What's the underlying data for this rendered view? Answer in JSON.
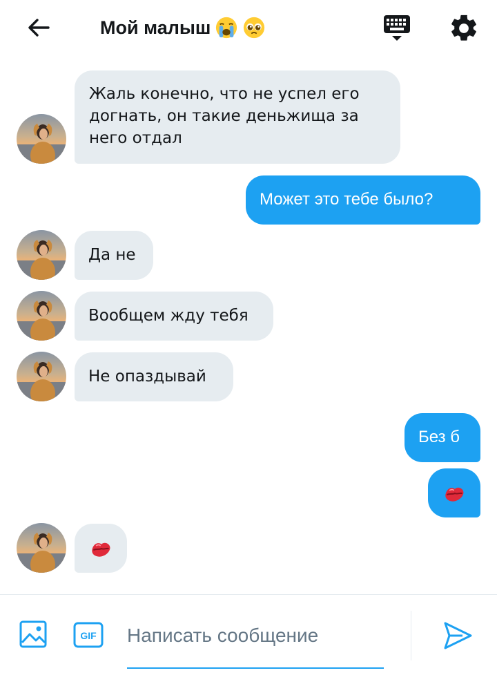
{
  "header": {
    "title": "Мой малыш",
    "title_emojis": [
      "loudly-crying-face",
      "pleading-face"
    ],
    "icons": [
      "back-arrow-icon",
      "keyboard-icon",
      "gear-icon"
    ]
  },
  "messages": [
    {
      "from": "them",
      "text": "Жаль конечно, что не успел его догнать, он такие деньжища за него отдал"
    },
    {
      "from": "me",
      "text": "Может это тебе было?"
    },
    {
      "from": "them",
      "text": "Да не"
    },
    {
      "from": "them",
      "text": "Вообщем жду тебя"
    },
    {
      "from": "them",
      "text": "Не опаздывай"
    },
    {
      "from": "me",
      "text": "Без б"
    },
    {
      "from": "me",
      "emoji": "kiss-mark"
    },
    {
      "from": "them",
      "emoji": "kiss-mark"
    }
  ],
  "composer": {
    "placeholder": "Написать сообщение",
    "gif_label": "GIF",
    "icons": [
      "image-icon",
      "gif-icon",
      "send-icon"
    ]
  },
  "colors": {
    "accent": "#1da1f2",
    "incoming_bubble": "#e6ecf0",
    "text": "#14171a",
    "placeholder": "#657786"
  }
}
